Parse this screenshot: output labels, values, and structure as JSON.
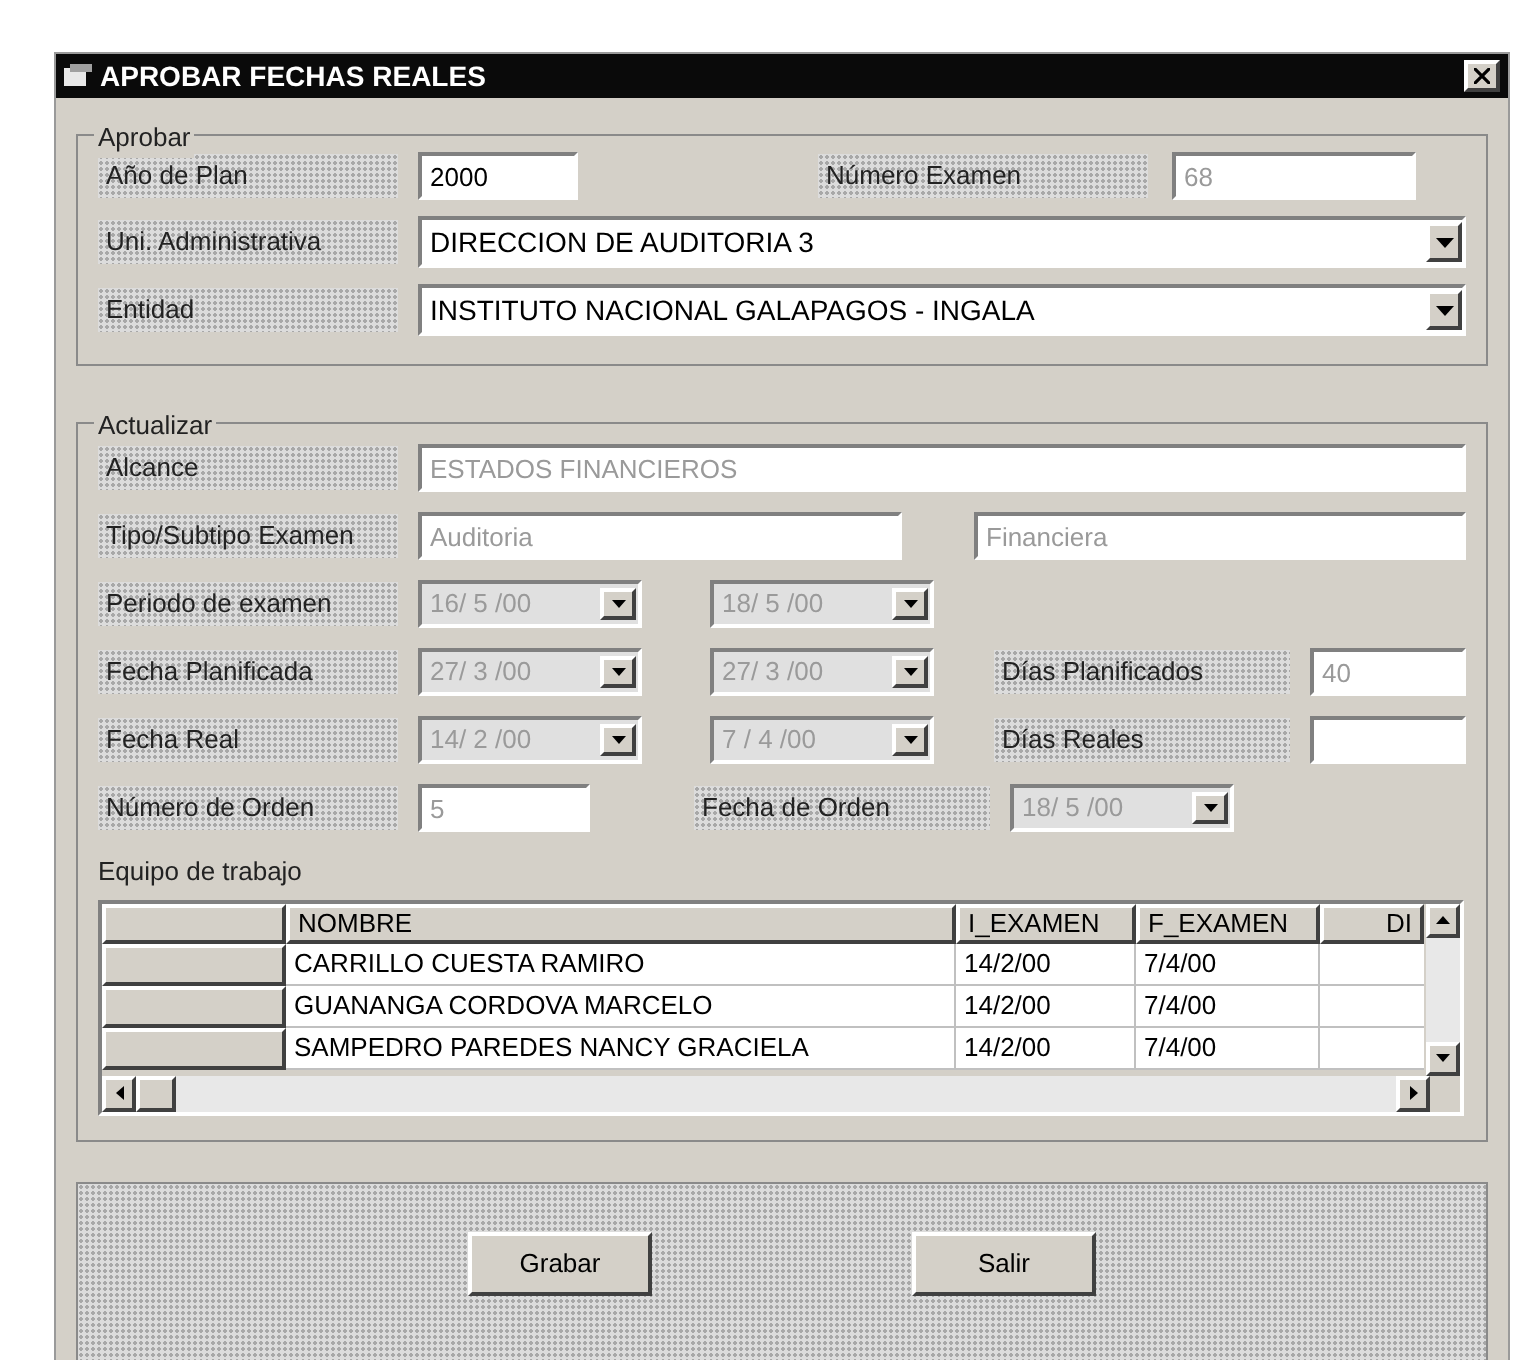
{
  "window": {
    "title": "APROBAR FECHAS REALES"
  },
  "aprobar": {
    "legend": "Aprobar",
    "ano_plan": {
      "label": "Año de Plan",
      "value": "2000",
      "disabled": false
    },
    "numero_examen": {
      "label": "Número Examen",
      "value": "68",
      "disabled": true
    },
    "unidad": {
      "label": "Uni. Administrativa",
      "value": "DIRECCION DE AUDITORIA 3"
    },
    "entidad": {
      "label": "Entidad",
      "value": "INSTITUTO NACIONAL GALAPAGOS - INGALA"
    }
  },
  "actualizar": {
    "legend": "Actualizar",
    "alcance": {
      "label": "Alcance",
      "value": "ESTADOS FINANCIEROS",
      "disabled": true
    },
    "tipo": {
      "label": "Tipo/Subtipo Examen",
      "tipo": {
        "value": "Auditoria",
        "disabled": true
      },
      "subtipo": {
        "value": "Financiera",
        "disabled": true
      }
    },
    "periodo": {
      "label": "Periodo de examen",
      "desde": {
        "value": "16/ 5 /00",
        "disabled": true
      },
      "hasta": {
        "value": "18/ 5 /00",
        "disabled": true
      }
    },
    "planificada": {
      "label": "Fecha Planificada",
      "desde": {
        "value": "27/ 3 /00",
        "disabled": true
      },
      "hasta": {
        "value": "27/ 3 /00",
        "disabled": true
      },
      "dias_label": "Días Planificados",
      "dias": {
        "value": "40",
        "disabled": true
      }
    },
    "real": {
      "label": "Fecha Real",
      "desde": {
        "value": "14/ 2 /00",
        "disabled": true
      },
      "hasta": {
        "value": "7 / 4 /00",
        "disabled": true
      },
      "dias_label": "Días Reales"
    },
    "orden": {
      "label": "Número de Orden",
      "numero": {
        "value": "5",
        "disabled": true
      },
      "fecha_label": "Fecha de Orden",
      "fecha": {
        "value": "18/ 5 /00",
        "disabled": true
      }
    }
  },
  "equipo": {
    "label": "Equipo de trabajo",
    "columns": [
      "NOMBRE",
      "I_EXAMEN",
      "F_EXAMEN",
      "DI"
    ],
    "rows": [
      {
        "cells": [
          "CARRILLO CUESTA RAMIRO",
          "14/2/00",
          "7/4/00"
        ]
      },
      {
        "cells": [
          "GUANANGA CORDOVA MARCELO",
          "14/2/00",
          "7/4/00"
        ]
      },
      {
        "cells": [
          "SAMPEDRO PAREDES NANCY GRACIELA",
          "14/2/00",
          "7/4/00"
        ]
      }
    ]
  },
  "buttons": [
    {
      "label": "Grabar"
    },
    {
      "label": "Salir"
    }
  ]
}
